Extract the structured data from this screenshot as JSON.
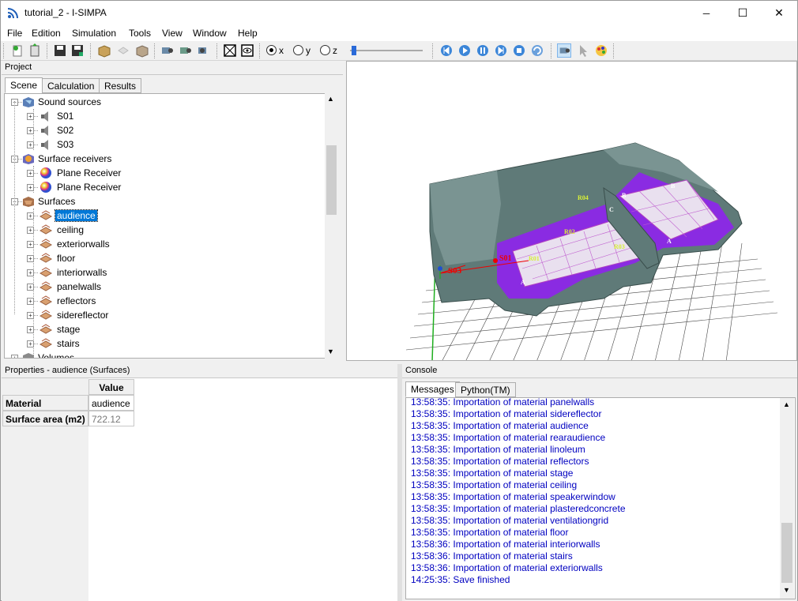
{
  "window": {
    "title": "tutorial_2 - I-SIMPA",
    "minimize_glyph": "─",
    "maximize_glyph": "☐",
    "close_glyph": "✕"
  },
  "menu": [
    "File",
    "Edition",
    "Simulation",
    "Tools",
    "View",
    "Window",
    "Help"
  ],
  "toolbar": {
    "axis_options": [
      "x",
      "y",
      "z"
    ],
    "selected_axis": "x"
  },
  "project": {
    "title": "Project",
    "tabs": [
      "Scene",
      "Calculation",
      "Results"
    ],
    "active_tab": "Scene",
    "tree": [
      {
        "label": "Sound sources",
        "level": 0,
        "expanded": true,
        "icon": "sound-sources-folder-icon"
      },
      {
        "label": "S01",
        "level": 1,
        "icon": "speaker-icon"
      },
      {
        "label": "S02",
        "level": 1,
        "icon": "speaker-icon"
      },
      {
        "label": "S03",
        "level": 1,
        "icon": "speaker-icon"
      },
      {
        "label": "Surface receivers",
        "level": 0,
        "expanded": true,
        "icon": "surface-receivers-folder-icon"
      },
      {
        "label": "Plane Receiver",
        "level": 1,
        "icon": "color-sphere-icon"
      },
      {
        "label": "Plane Receiver",
        "level": 1,
        "icon": "color-sphere-icon"
      },
      {
        "label": "Surfaces",
        "level": 0,
        "expanded": true,
        "icon": "surfaces-folder-icon"
      },
      {
        "label": "audience",
        "level": 1,
        "icon": "surface-group-icon",
        "selected": true
      },
      {
        "label": "ceiling",
        "level": 1,
        "icon": "surface-group-icon"
      },
      {
        "label": "exteriorwalls",
        "level": 1,
        "icon": "surface-group-icon"
      },
      {
        "label": "floor",
        "level": 1,
        "icon": "surface-group-icon"
      },
      {
        "label": "interiorwalls",
        "level": 1,
        "icon": "surface-group-icon"
      },
      {
        "label": "panelwalls",
        "level": 1,
        "icon": "surface-group-icon"
      },
      {
        "label": "reflectors",
        "level": 1,
        "icon": "surface-group-icon"
      },
      {
        "label": "sidereflector",
        "level": 1,
        "icon": "surface-group-icon"
      },
      {
        "label": "stage",
        "level": 1,
        "icon": "surface-group-icon"
      },
      {
        "label": "stairs",
        "level": 1,
        "icon": "surface-group-icon"
      },
      {
        "label": "Volumes",
        "level": 0,
        "icon": "volumes-folder-icon"
      }
    ]
  },
  "viewport": {
    "labels": [
      "S03",
      "S01",
      "R01",
      "R02",
      "R03",
      "R04",
      "A",
      "B",
      "C",
      "A",
      "B"
    ]
  },
  "properties": {
    "title": "Properties - audience (Surfaces)",
    "value_header": "Value",
    "rows": [
      {
        "name": "Material",
        "value": "audience",
        "readonly": false
      },
      {
        "name": "Surface area (m2)",
        "value": "722.12",
        "readonly": true
      }
    ]
  },
  "console": {
    "title": "Console",
    "tabs": [
      "Messages",
      "Python(TM)"
    ],
    "active_tab": "Messages",
    "messages": [
      "13:58:35: Importation of material panelwalls",
      "13:58:35: Importation of material sidereflector",
      "13:58:35: Importation of material audience",
      "13:58:35: Importation of material rearaudience",
      "13:58:35: Importation of material linoleum",
      "13:58:35: Importation of material reflectors",
      "13:58:35: Importation of material stage",
      "13:58:35: Importation of material ceiling",
      "13:58:35: Importation of material speakerwindow",
      "13:58:35: Importation of material plasteredconcrete",
      "13:58:35: Importation of material ventilationgrid",
      "13:58:35: Importation of material floor",
      "13:58:36: Importation of material interiorwalls",
      "13:58:36: Importation of material stairs",
      "13:58:36: Importation of material exteriorwalls",
      "14:25:35: Save finished"
    ],
    "message_color": "#0000c0"
  },
  "colors": {
    "selection": "#0078d7",
    "geometry": "#5f7a78",
    "magenta": "#8a2be2",
    "grid": "#444444"
  }
}
